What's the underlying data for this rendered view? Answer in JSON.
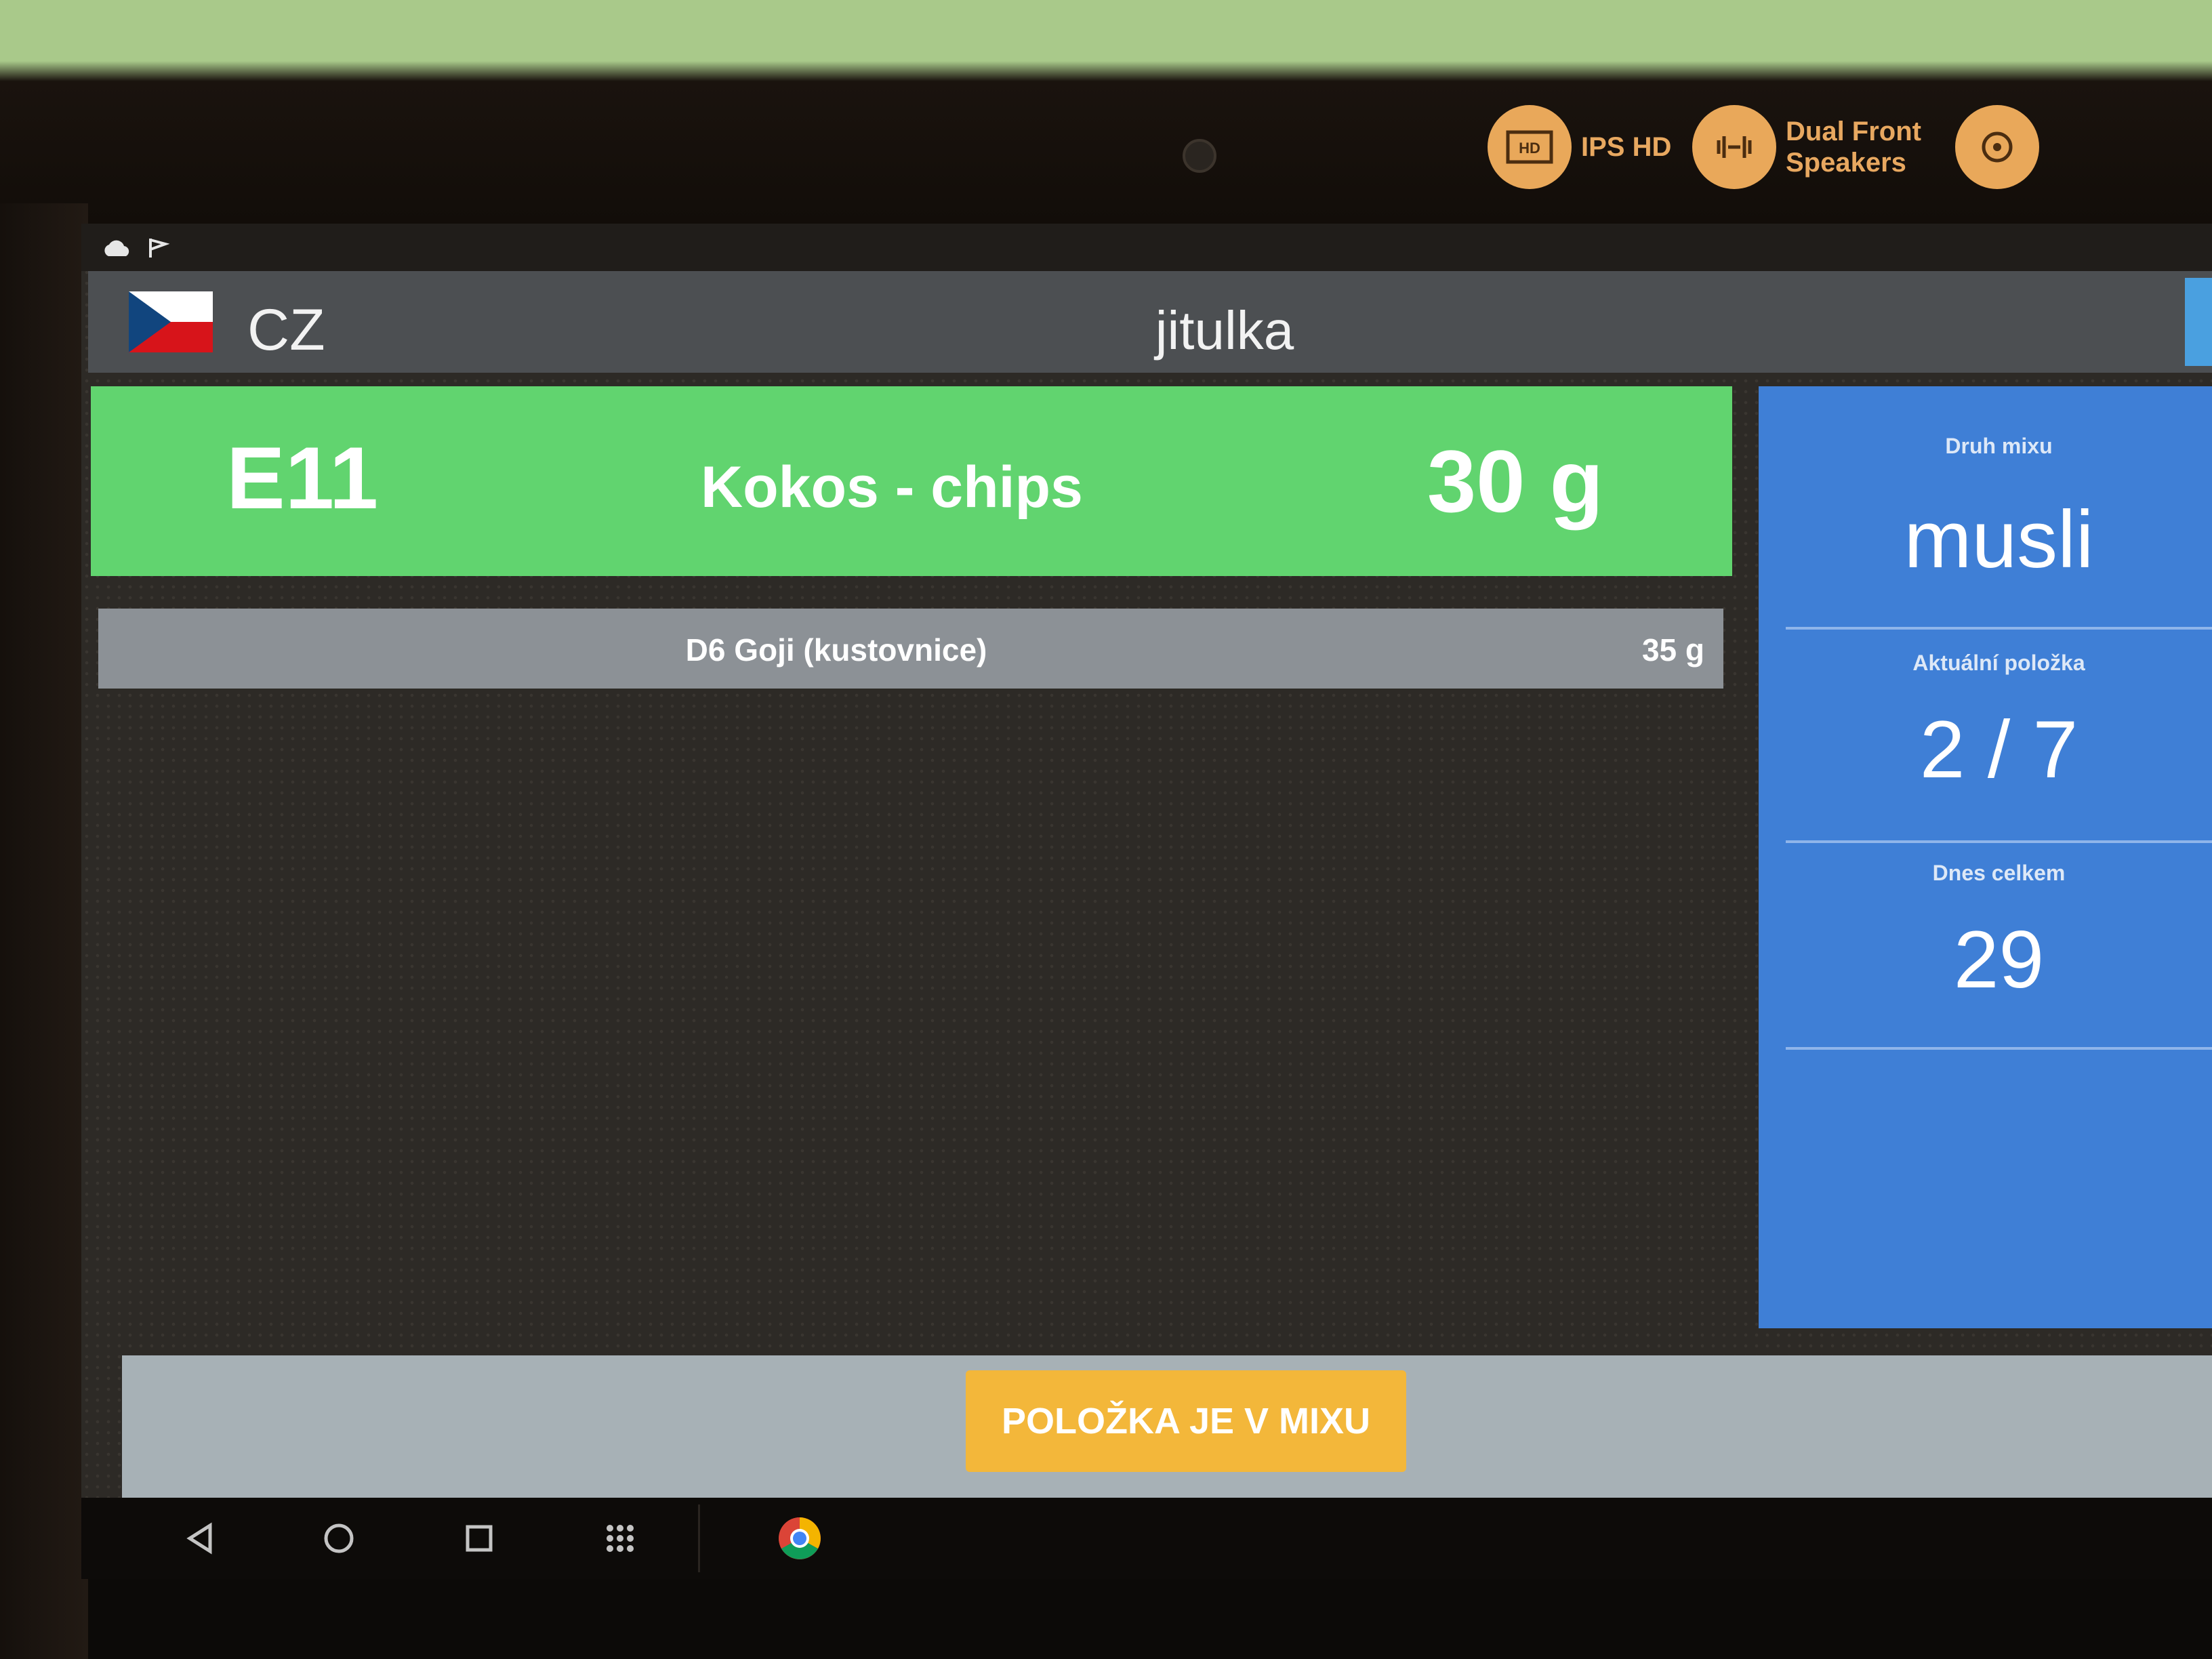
{
  "device": {
    "features": [
      {
        "icon": "hd-screen-icon",
        "label": "IPS HD"
      },
      {
        "icon": "speaker-icon",
        "label": "Dual Front Speakers"
      },
      {
        "icon": "camera-sensor-icon",
        "label": ""
      }
    ]
  },
  "statusbar": {
    "icons": [
      "cloud-icon",
      "flag-icon"
    ]
  },
  "header": {
    "language": "CZ",
    "username": "jitulka"
  },
  "current_item": {
    "code": "E11",
    "name": "Kokos - chips",
    "weight": "30 g",
    "color": "#61d46f"
  },
  "next_item": {
    "name": "D6 Goji (kustovnice)",
    "weight": "35 g"
  },
  "info_panel": {
    "color": "#3f7fd6",
    "mix_type_label": "Druh mixu",
    "mix_type_value": "musli",
    "current_item_label": "Aktuální položka",
    "current_item_value": "2 / 7",
    "today_total_label": "Dnes celkem",
    "today_total_value": "29"
  },
  "action": {
    "confirm_label": "POLOŽKA JE V MIXU",
    "color": "#f3b73a"
  },
  "navbar": {
    "buttons": [
      "back-icon",
      "home-icon",
      "recents-icon",
      "apps-grid-icon",
      "chrome-icon"
    ]
  }
}
